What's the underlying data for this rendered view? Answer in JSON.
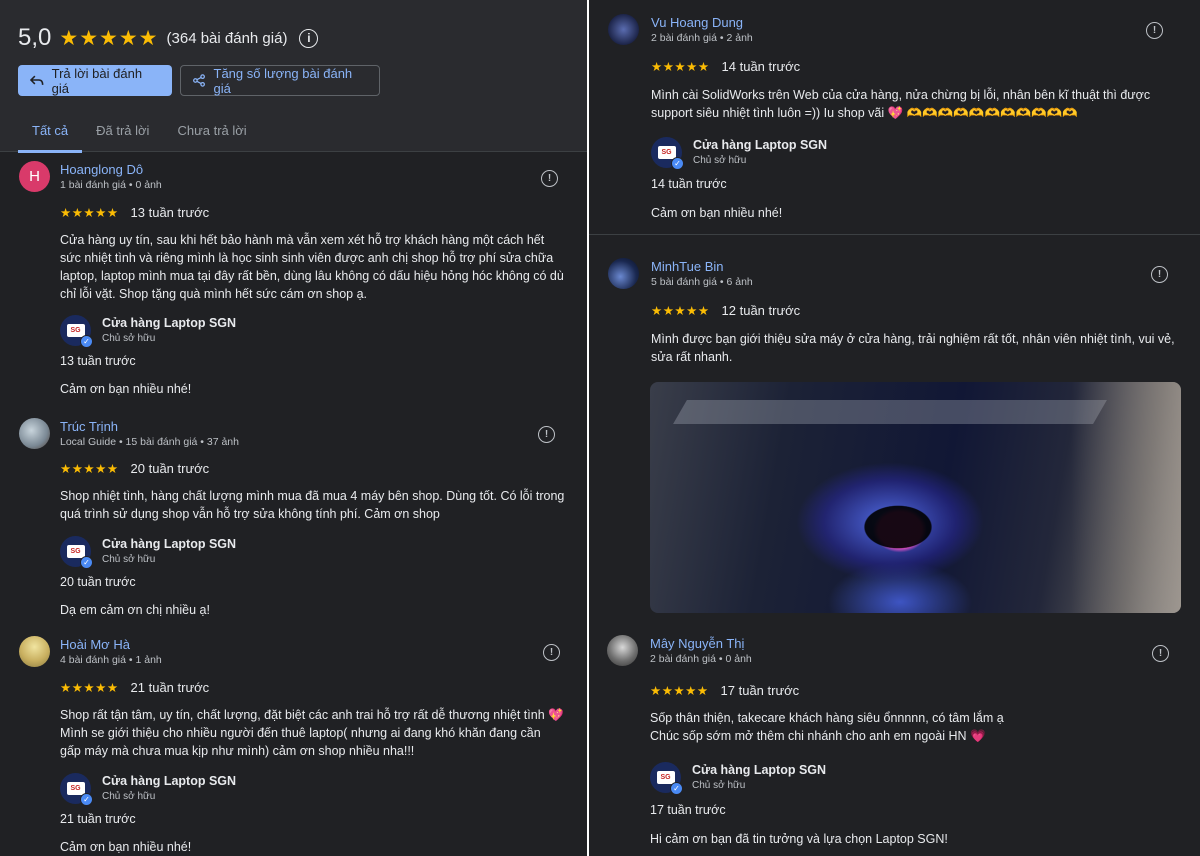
{
  "summary": {
    "rating": "5,0",
    "stars": "★★★★★",
    "count": "(364 bài đánh giá)",
    "info_icon": "i"
  },
  "buttons": {
    "reply_label": "Trả lời bài đánh giá",
    "increase_label": "Tăng số lượng bài đánh giá"
  },
  "tabs": [
    {
      "label": "Tất cả",
      "active": true
    },
    {
      "label": "Đã trả lời",
      "active": false
    },
    {
      "label": "Chưa trả lời",
      "active": false
    }
  ],
  "owner": {
    "name": "Cửa hàng Laptop SGN",
    "role": "Chủ sở hữu",
    "logo_text": "SG"
  },
  "reviews": [
    {
      "name": "Hoanglong Dô",
      "avatar_letter": "H",
      "meta": "1 bài đánh giá • 0 ảnh",
      "stars": "★★★★★",
      "time": "13 tuần trước",
      "text": "Cửa hàng uy tín, sau khi hết bảo hành mà vẫn xem xét hỗ trợ khách hàng một cách hết sức nhiệt tình và riêng mình là học sinh sinh viên được anh chị shop hỗ trợ phí sửa chữa laptop, laptop mình mua tại đây rất bền, dùng lâu không có dấu hiệu hỏng hóc không có dù chỉ lỗi vặt. Shop tặng quà mình hết sức cám ơn shop ạ.",
      "reply_time": "13 tuần trước",
      "reply": "Cảm ơn bạn nhiều nhé!"
    },
    {
      "name": "Trúc Trịnh",
      "meta": "Local Guide • 15 bài đánh giá • 37 ảnh",
      "stars": "★★★★★",
      "time": "20 tuần trước",
      "text": "Shop nhiệt tình, hàng chất lượng mình mua đã mua 4 máy bên shop. Dùng tốt. Có lỗi trong quá trình sử dụng shop vẫn hỗ trợ sửa không tính phí. Cảm ơn shop",
      "reply_time": "20 tuần trước",
      "reply": "Dạ em cảm ơn chị nhiều ạ!"
    },
    {
      "name": "Hoài Mơ Hà",
      "meta": "4 bài đánh giá • 1 ảnh",
      "stars": "★★★★★",
      "time": "21 tuần trước",
      "text": "Shop rất tận tâm, uy tín, chất lượng, đặt biệt các anh trai hỗ trợ rất dễ thương nhiệt tình 💖 Mình se giới thiệu cho nhiều người đến thuê laptop( nhưng ai đang khó khăn đang cần gấp máy mà chưa mua kịp như mình) cảm ơn shop nhiều nha!!!",
      "reply_time": "21 tuần trước",
      "reply": "Cảm ơn bạn nhiều nhé!"
    },
    {
      "name": "Vu Hoang Dung",
      "meta": "2 bài đánh giá • 2 ảnh",
      "stars": "★★★★★",
      "time": "14 tuần trước",
      "text": "Mình cài SolidWorks trên Web của cửa hàng, nửa chừng bị lỗi, nhân bên kĩ thuật thì được support siêu nhiệt tình luôn =)) Iu shop vãi 💖 🫶🫶🫶🫶🫶🫶🫶🫶🫶🫶🫶",
      "reply_time": "14 tuần trước",
      "reply": "Cảm ơn bạn nhiều nhé!"
    },
    {
      "name": "MinhTue Bin",
      "meta": "5 bài đánh giá • 6 ảnh",
      "stars": "★★★★★",
      "time": "12 tuần trước",
      "text": "Mình được bạn giới thiệu sửa máy ở cửa hàng, trải nghiệm rất tốt, nhân viên nhiệt tình, vui vẻ, sửa rất nhanh."
    },
    {
      "name": "Mây Nguyễn Thị",
      "meta": "2 bài đánh giá • 0 ảnh",
      "stars": "★★★★★",
      "time": "17 tuần trước",
      "text": "Sốp thân thiện, takecare khách hàng siêu ổnnnnn, có tâm lắm ạ\nChúc sốp sớm mở thêm chi nhánh cho anh em ngoài HN 💗",
      "reply_time": "17 tuần trước",
      "reply": "Hi cảm ơn bạn đã tin tưởng và lựa chọn Laptop SGN!"
    }
  ]
}
